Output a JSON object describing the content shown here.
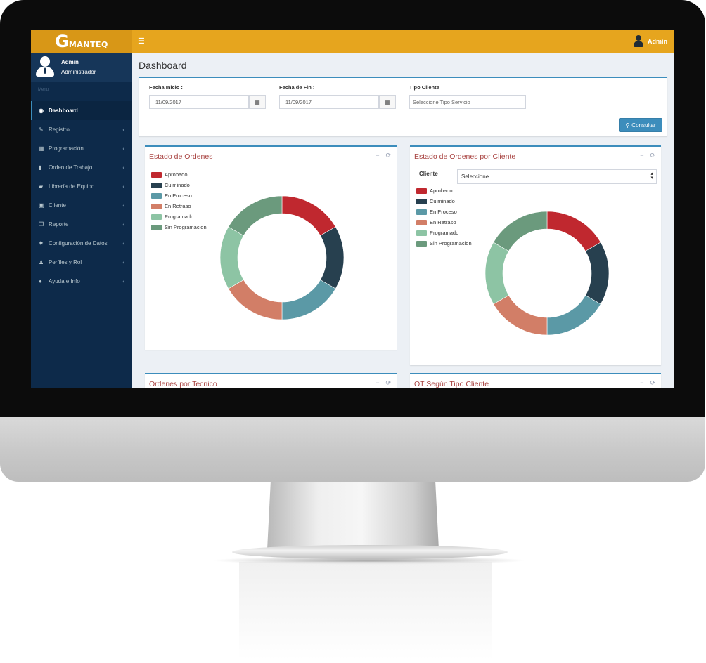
{
  "brand": {
    "logo_g": "G",
    "logo_text": "MANTEQ"
  },
  "topbar": {
    "menu_icon": "hamburger-icon",
    "user": "Admin"
  },
  "sidebar": {
    "user_name": "Admin",
    "user_role": "Administrador",
    "menu_header": "Menu",
    "items": [
      {
        "label": "Dashboard",
        "icon": "dashboard-icon",
        "glyph": "◉",
        "active": true
      },
      {
        "label": "Registro",
        "icon": "edit-icon",
        "glyph": "✎",
        "active": false
      },
      {
        "label": "Programación",
        "icon": "calendar-icon",
        "glyph": "▦",
        "active": false
      },
      {
        "label": "Orden de Trabajo",
        "icon": "file-icon",
        "glyph": "▮",
        "active": false
      },
      {
        "label": "Librería de Equipo",
        "icon": "book-icon",
        "glyph": "▰",
        "active": false
      },
      {
        "label": "Cliente",
        "icon": "id-card-icon",
        "glyph": "▣",
        "active": false
      },
      {
        "label": "Reporte",
        "icon": "copy-icon",
        "glyph": "❐",
        "active": false
      },
      {
        "label": "Configuración de Datos",
        "icon": "gear-icon",
        "glyph": "✱",
        "active": false
      },
      {
        "label": "Perfiles y Rol",
        "icon": "user-icon",
        "glyph": "♟",
        "active": false
      },
      {
        "label": "Ayuda e Info",
        "icon": "info-icon",
        "glyph": "●",
        "active": false
      }
    ]
  },
  "page": {
    "title": "Dashboard"
  },
  "filters": {
    "fecha_inicio_label": "Fecha Inicio :",
    "fecha_inicio_value": "11/09/2017",
    "fecha_fin_label": "Fecha de Fin :",
    "fecha_fin_value": "11/09/2017",
    "tipo_cliente_label": "Tipo Cliente",
    "tipo_cliente_placeholder": "Seleccione Tipo Servicio",
    "consultar_label": "Consultar"
  },
  "boxes": {
    "estado_ordenes_title": "Estado de Ordenes",
    "estado_cliente_title": "Estado de Ordenes por Cliente",
    "ordenes_tecnico_title": "Ordenes por Tecnico",
    "ot_tipo_cliente_title": "OT Según Tipo Cliente",
    "collapse_glyph": "−",
    "refresh_glyph": "⟳",
    "cliente_label": "Cliente",
    "cliente_select": "Seleccione"
  },
  "legend": [
    {
      "label": "Aprobado",
      "color": "#c0282f"
    },
    {
      "label": "Culminado",
      "color": "#27404f"
    },
    {
      "label": "En Proceso",
      "color": "#5b99a6"
    },
    {
      "label": "En Retraso",
      "color": "#d27e67"
    },
    {
      "label": "Programado",
      "color": "#8dc4a4"
    },
    {
      "label": "Sin Programacion",
      "color": "#6b9a7d"
    }
  ],
  "chart_data": [
    {
      "type": "pie",
      "title": "Estado de Ordenes",
      "categories": [
        "Aprobado",
        "Culminado",
        "En Proceso",
        "En Retraso",
        "Programado",
        "Sin Programacion"
      ],
      "values": [
        16.7,
        16.7,
        16.7,
        16.7,
        16.7,
        16.7
      ],
      "colors": [
        "#c0282f",
        "#27404f",
        "#5b99a6",
        "#d27e67",
        "#8dc4a4",
        "#6b9a7d"
      ],
      "legend": "top-left"
    },
    {
      "type": "pie",
      "title": "Estado de Ordenes por Cliente",
      "categories": [
        "Aprobado",
        "Culminado",
        "En Proceso",
        "En Retraso",
        "Programado",
        "Sin Programacion"
      ],
      "values": [
        16.7,
        16.7,
        16.7,
        16.7,
        16.7,
        16.7
      ],
      "colors": [
        "#c0282f",
        "#27404f",
        "#5b99a6",
        "#d27e67",
        "#8dc4a4",
        "#6b9a7d"
      ],
      "legend": "top-left"
    }
  ]
}
